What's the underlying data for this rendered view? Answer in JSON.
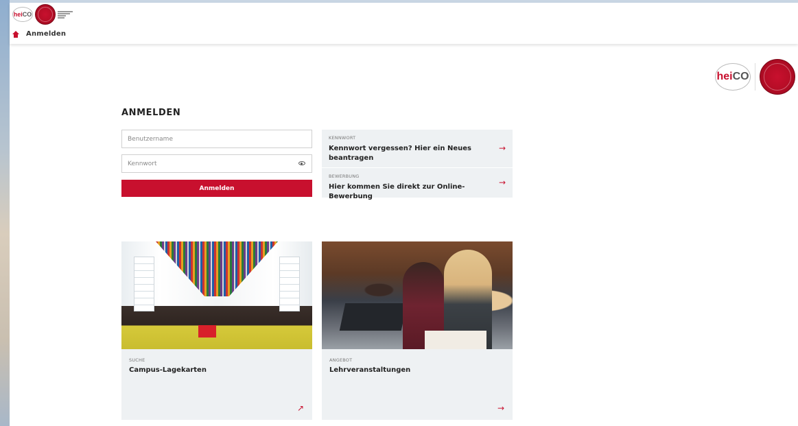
{
  "header": {
    "breadcrumb": "Anmelden",
    "logo_small": {
      "hei": "hei",
      "co": "CO"
    },
    "logo_big": {
      "hei": "hei",
      "co": "CO"
    }
  },
  "login": {
    "title": "ANMELDEN",
    "username_placeholder": "Benutzername",
    "password_placeholder": "Kennwort",
    "submit_label": "Anmelden"
  },
  "links": [
    {
      "label": "KENNWORT",
      "text": "Kennwort vergessen? Hier ein Neues beantragen",
      "arrow": "→"
    },
    {
      "label": "BEWERBUNG",
      "text": "Hier kommen Sie direkt zur Online-Bewerbung",
      "arrow": "→"
    }
  ],
  "cards": [
    {
      "label": "SUCHE",
      "text": "Campus-Lagekarten",
      "arrow": "↗"
    },
    {
      "label": "ANGEBOT",
      "text": "Lehrveranstaltungen",
      "arrow": "→"
    }
  ],
  "colors": {
    "accent": "#c8102e",
    "panel": "#eef1f3"
  }
}
